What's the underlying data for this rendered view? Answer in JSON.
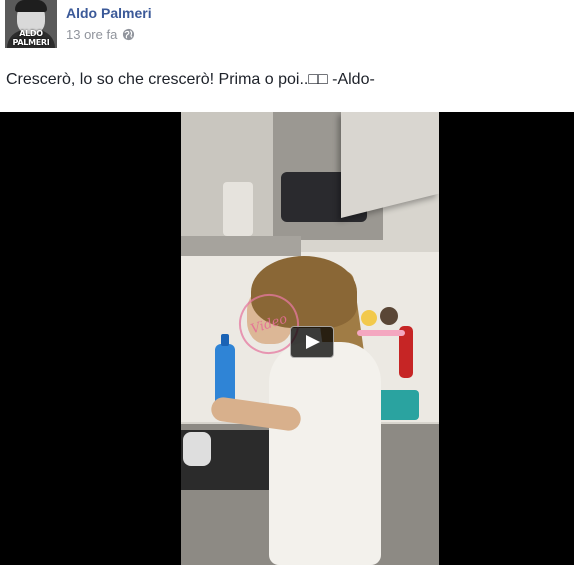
{
  "post": {
    "author": "Aldo Palmeri",
    "avatar_caption": "ALDO PALMERI",
    "timestamp": "13 ore fa",
    "privacy_icon": "globe-icon",
    "status_text": "Crescerò, lo so che crescerò! Prima o poi..□□ -Aldo-",
    "watermark_text": "Video"
  },
  "video": {
    "play_icon": "play-icon"
  },
  "colors": {
    "author_link": "#3b5998",
    "meta_text": "#90949c",
    "body_text": "#1d2129",
    "video_background": "#000000"
  }
}
